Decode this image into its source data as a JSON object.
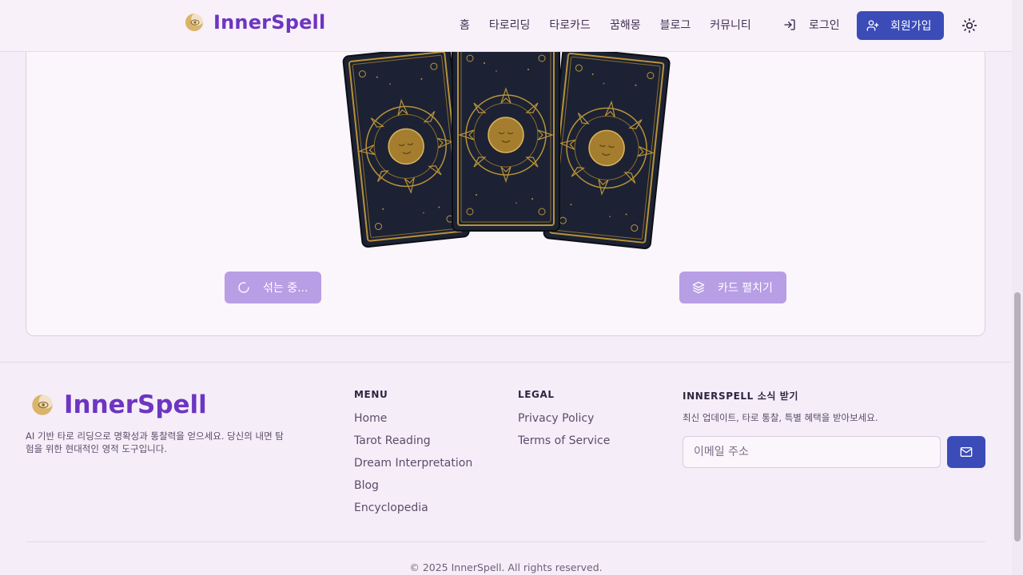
{
  "header": {
    "logo_text": "InnerSpell",
    "nav": [
      "홈",
      "타로리딩",
      "타로카드",
      "꿈해몽",
      "블로그",
      "커뮤니티"
    ],
    "login_label": "로그인",
    "signup_label": "회원가입"
  },
  "main": {
    "shuffle_label": "섞는 중...",
    "spread_label": "카드 펼치기"
  },
  "footer": {
    "logo_text": "InnerSpell",
    "description": "AI 기반 타로 리딩으로 명확성과 통찰력을 얻으세요. 당신의 내면 탐험을 위한 현대적인 영적 도구입니다.",
    "menu_title": "MENU",
    "menu_links": [
      "Home",
      "Tarot Reading",
      "Dream Interpretation",
      "Blog",
      "Encyclopedia"
    ],
    "legal_title": "LEGAL",
    "legal_links": [
      "Privacy Policy",
      "Terms of Service"
    ],
    "news_title": "INNERSPELL 소식 받기",
    "news_desc": "최신 업데이트, 타로 통찰, 특별 혜택을 받아보세요.",
    "email_placeholder": "이메일 주소",
    "copyright": "© 2025 InnerSpell. All rights reserved."
  },
  "colors": {
    "brand_purple": "#6d35c1",
    "primary_blue": "#3b4cb8",
    "disabled_button": "#b89ee5",
    "card_gold": "#b8923a",
    "card_navy": "#1c2233"
  }
}
